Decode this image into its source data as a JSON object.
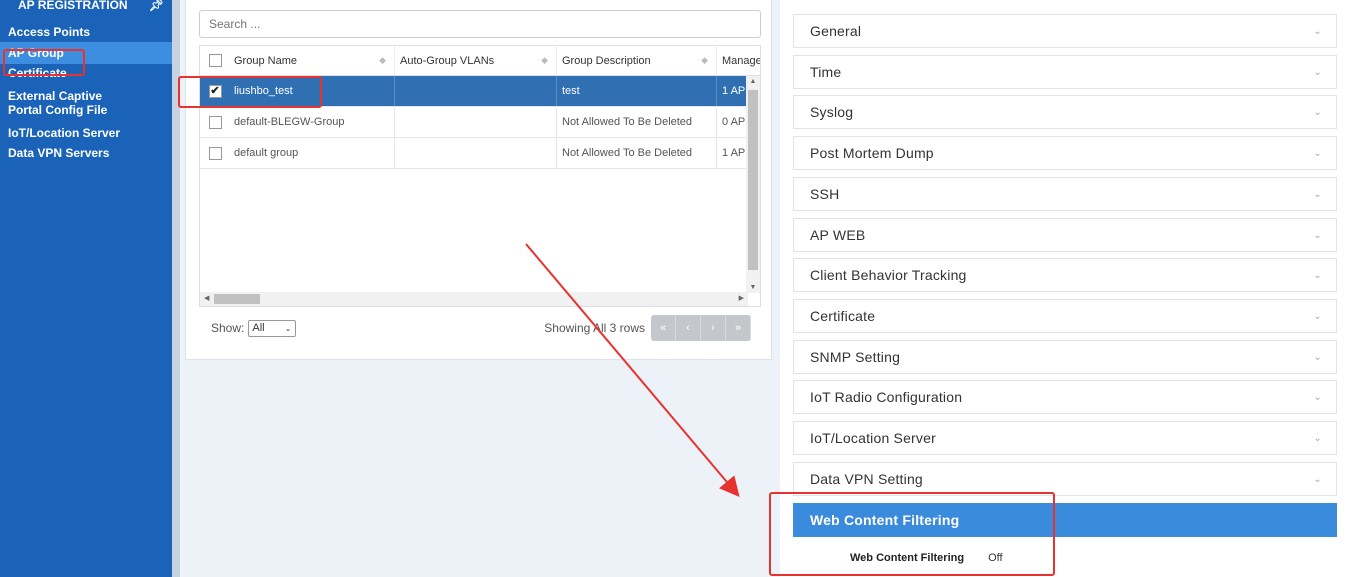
{
  "sidebar": {
    "header": "AP REGISTRATION",
    "items": [
      {
        "label": "Access Points"
      },
      {
        "label": "AP Group"
      },
      {
        "label": "Certificate"
      },
      {
        "label": "External Captive Portal Config File"
      },
      {
        "label": "IoT/Location Server"
      },
      {
        "label": "Data VPN Servers"
      }
    ],
    "active_index": 1
  },
  "table": {
    "search_placeholder": "Search ...",
    "columns": [
      "Group Name",
      "Auto-Group VLANs",
      "Group Description",
      "Manage"
    ],
    "rows": [
      {
        "name": "liushbo_test",
        "vlans": "",
        "description": "test",
        "manage": "1 AP",
        "selected": true
      },
      {
        "name": "default-BLEGW-Group",
        "vlans": "",
        "description": "Not Allowed To Be Deleted",
        "manage": "0 AP",
        "selected": false
      },
      {
        "name": "default group",
        "vlans": "",
        "description": "Not Allowed To Be Deleted",
        "manage": "1 AP",
        "selected": false
      }
    ],
    "footer": {
      "show_label": "Show:",
      "show_value": "All",
      "rows_info": "Showing All 3 rows",
      "pager": [
        "«",
        "‹",
        "›",
        "»"
      ]
    }
  },
  "right": {
    "sections": [
      "General",
      "Time",
      "Syslog",
      "Post Mortem Dump",
      "SSH",
      "AP WEB",
      "Client Behavior Tracking",
      "Certificate",
      "SNMP Setting",
      "IoT Radio Configuration",
      "IoT/Location Server",
      "Data VPN Setting"
    ],
    "open_section": "Web Content Filtering",
    "field": {
      "label": "Web Content Filtering",
      "value": "Off"
    }
  },
  "colors": {
    "sidebar_bg": "#1a63b8",
    "sidebar_active": "#3d8ee0",
    "row_selected": "#2f6fb2",
    "accordion_open": "#3b8bdc",
    "annotation_red": "#e8322f"
  }
}
